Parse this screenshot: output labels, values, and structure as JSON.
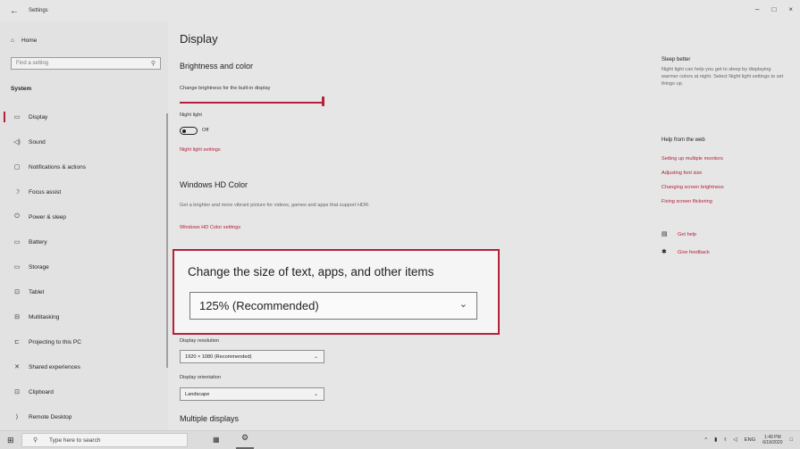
{
  "window": {
    "title": "Settings",
    "back_icon": "←",
    "minimize": "–",
    "maximize": "□",
    "close": "×"
  },
  "sidebar": {
    "home": "Home",
    "search_placeholder": "Find a setting",
    "section": "System",
    "items": [
      {
        "label": "Display",
        "icon": "▭"
      },
      {
        "label": "Sound",
        "icon": "◁)"
      },
      {
        "label": "Notifications & actions",
        "icon": "▢"
      },
      {
        "label": "Focus assist",
        "icon": "☽"
      },
      {
        "label": "Power & sleep",
        "icon": "⏻"
      },
      {
        "label": "Battery",
        "icon": "▭"
      },
      {
        "label": "Storage",
        "icon": "▭"
      },
      {
        "label": "Tablet",
        "icon": "⊡"
      },
      {
        "label": "Multitasking",
        "icon": "⊟"
      },
      {
        "label": "Projecting to this PC",
        "icon": "⊏"
      },
      {
        "label": "Shared experiences",
        "icon": "✕"
      },
      {
        "label": "Clipboard",
        "icon": "⊡"
      },
      {
        "label": "Remote Desktop",
        "icon": "⟩"
      }
    ]
  },
  "main": {
    "title": "Display",
    "brightness_heading": "Brightness and color",
    "brightness_label": "Change brightness for the built-in display",
    "night_light_label": "Night light",
    "night_light_state": "Off",
    "night_light_link": "Night light settings",
    "hdr_heading": "Windows HD Color",
    "hdr_desc": "Get a brighter and more vibrant picture for videos, games and apps that support HDR.",
    "hdr_link": "Windows HD Color settings",
    "scale_heading": "Change the size of text, apps, and other items",
    "scale_value": "125% (Recommended)",
    "resolution_label": "Display resolution",
    "resolution_value": "1920 × 1080 (Recommended)",
    "orientation_label": "Display orientation",
    "orientation_value": "Landscape",
    "multiple_displays_heading": "Multiple displays"
  },
  "right": {
    "sleep_heading": "Sleep better",
    "sleep_desc": "Night light can help you get to sleep by displaying warmer colors at night. Select Night light settings to set things up.",
    "web_heading": "Help from the web",
    "links": [
      "Setting up multiple monitors",
      "Adjusting font size",
      "Changing screen brightness",
      "Fixing screen flickering"
    ],
    "get_help": "Get help",
    "give_feedback": "Give feedback"
  },
  "taskbar": {
    "search_placeholder": "Type here to search",
    "lang": "ENG",
    "time": "1:49 PM",
    "date": "6/19/2020"
  },
  "colors": {
    "accent": "#b5203a",
    "background": "#e6e6e6"
  }
}
